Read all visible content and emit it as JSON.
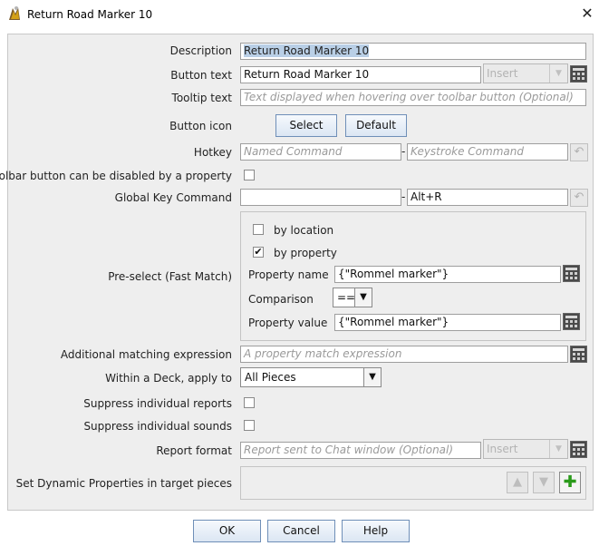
{
  "window": {
    "title": "Return Road Marker 10",
    "close_glyph": "✕"
  },
  "form": {
    "description": {
      "label": "Description",
      "value": "Return Road Marker 10"
    },
    "button_text": {
      "label": "Button text",
      "value": "Return Road Marker 10",
      "insert_label": "Insert"
    },
    "tooltip_text": {
      "label": "Tooltip text",
      "placeholder": "Text displayed when hovering over toolbar button (Optional)"
    },
    "button_icon": {
      "label": "Button icon",
      "select_label": "Select",
      "default_label": "Default"
    },
    "hotkey": {
      "label": "Hotkey",
      "named_placeholder": "Named Command",
      "separator": "-",
      "keystroke_placeholder": "Keystroke Command"
    },
    "toolbar_disable": {
      "label": "Toolbar button can be disabled by a property",
      "checked": false
    },
    "global_key_command": {
      "label": "Global Key Command",
      "named_value": "",
      "separator": "-",
      "keystroke_value": "Alt+R"
    },
    "preselect": {
      "label": "Pre-select (Fast Match)",
      "by_location": {
        "label": "by location",
        "checked": false
      },
      "by_property": {
        "label": "by property",
        "checked": true,
        "glyph": "✔"
      },
      "property_name": {
        "label": "Property name",
        "value": "{\"Rommel marker\"}"
      },
      "comparison": {
        "label": "Comparison",
        "value": "=="
      },
      "property_value": {
        "label": "Property value",
        "value": "{\"Rommel marker\"}"
      }
    },
    "additional_matching": {
      "label": "Additional matching expression",
      "placeholder": "A property match expression"
    },
    "within_deck": {
      "label": "Within a Deck, apply to",
      "value": "All Pieces"
    },
    "suppress_reports": {
      "label": "Suppress individual reports",
      "checked": false
    },
    "suppress_sounds": {
      "label": "Suppress individual sounds",
      "checked": false
    },
    "report_format": {
      "label": "Report format",
      "placeholder": "Report sent to Chat window (Optional)",
      "insert_label": "Insert"
    },
    "dynamic_properties": {
      "label": "Set Dynamic Properties in target pieces",
      "up_glyph": "▲",
      "down_glyph": "▼",
      "add_glyph": "✚"
    }
  },
  "footer": {
    "ok_label": "OK",
    "cancel_label": "Cancel",
    "help_label": "Help"
  },
  "icons": {
    "dropdown_arrow": "▼",
    "undo_arrow": "↶"
  }
}
